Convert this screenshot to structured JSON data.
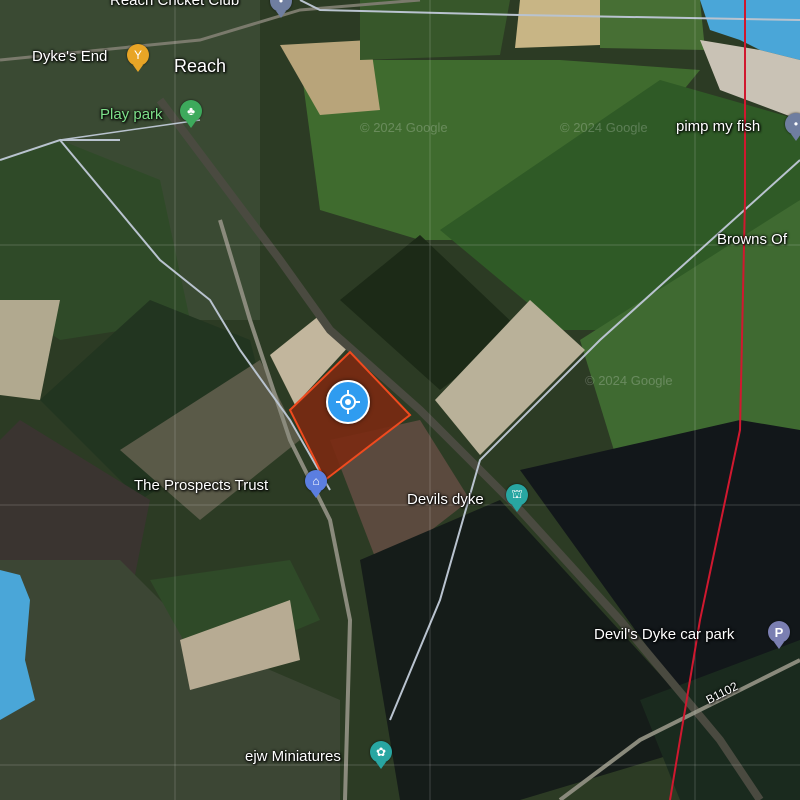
{
  "map": {
    "labels": {
      "cricket_club": "Reach Cricket Club",
      "dykes_end": "Dyke's End",
      "reach": "Reach",
      "play_park": "Play park",
      "pimp_my_fish": "pimp my fish",
      "browns_of": "Browns Of",
      "prospects_trust": "The Prospects Trust",
      "devils_dyke": "Devils dyke",
      "devils_dyke_car_park": "Devil's Dyke car park",
      "b1102": "B1102",
      "ejw_miniatures": "ejw Miniatures"
    },
    "watermarks": {
      "google_1": "© 2024 Google",
      "google_2": "© 2024 Google",
      "google_3": "© 2024 Google"
    },
    "icons": {
      "cricket": "pin-icon",
      "dykes_end": "pub-icon",
      "play_park": "tree-icon",
      "pimp_my_fish": "shop-icon",
      "prospects_trust": "building-icon",
      "devils_dyke": "landmark-icon",
      "car_park": "parking-icon",
      "ejw_miniatures": "palette-icon",
      "locator": "crosshair-icon"
    },
    "colors": {
      "selected_field": "#7a2a12",
      "selected_border": "#f04a1e",
      "water": "#4aa6d8",
      "boundary_line": "#d0182f",
      "locator": "#2f9cf0"
    }
  }
}
